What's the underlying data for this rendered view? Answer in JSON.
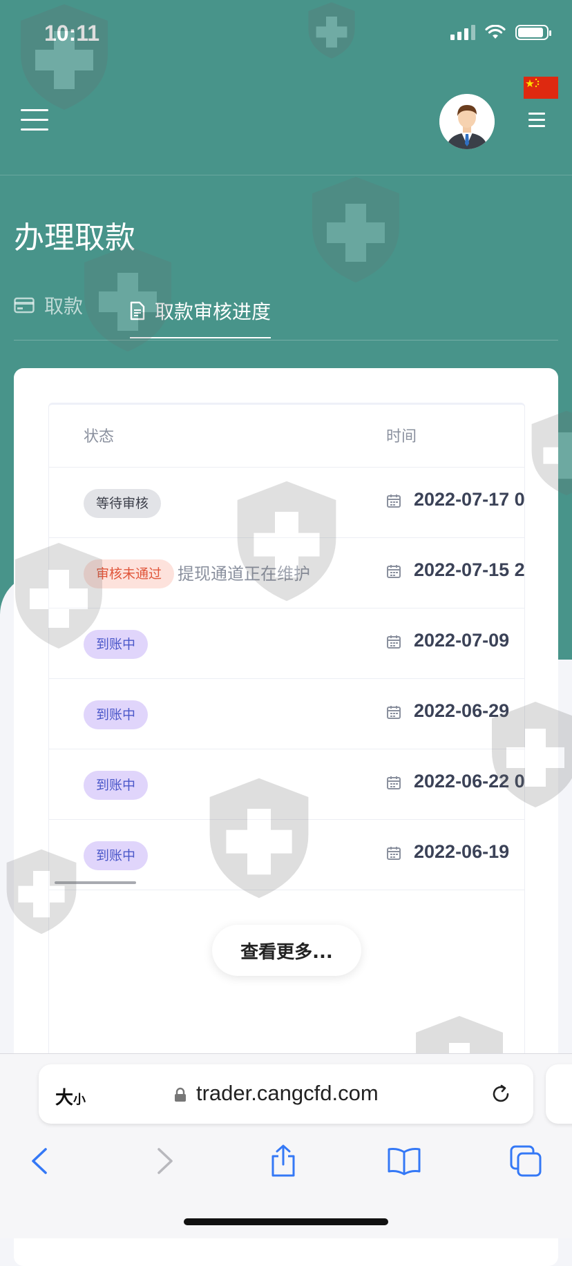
{
  "status_bar": {
    "time": "10:11"
  },
  "header": {
    "avatar_alt": "user avatar"
  },
  "page": {
    "title": "办理取款"
  },
  "tabs": [
    {
      "label": "取款",
      "active": false
    },
    {
      "label": "取款审核进度",
      "active": true
    }
  ],
  "table": {
    "headers": {
      "status": "状态",
      "time": "时间"
    },
    "rows": [
      {
        "status": "等待审核",
        "status_style": "gray",
        "note": "",
        "date": "2022-07-17 0"
      },
      {
        "status": "审核未通过",
        "status_style": "red",
        "note": "提现通道正在维护",
        "date": "2022-07-15 2"
      },
      {
        "status": "到账中",
        "status_style": "purple",
        "note": "",
        "date": "2022-07-09"
      },
      {
        "status": "到账中",
        "status_style": "purple",
        "note": "",
        "date": "2022-06-29"
      },
      {
        "status": "到账中",
        "status_style": "purple",
        "note": "",
        "date": "2022-06-22 0"
      },
      {
        "status": "到账中",
        "status_style": "purple",
        "note": "",
        "date": "2022-06-19"
      }
    ],
    "more_button": "查看更多..."
  },
  "browser": {
    "text_size_big": "大",
    "text_size_small": "小",
    "url": "trader.cangcfd.com"
  },
  "colors": {
    "primary": "#48948a",
    "badge_gray": "#e2e3e7",
    "badge_red": "#fde2dc",
    "badge_purple": "#e0d5fb",
    "ios_blue": "#3478f6"
  }
}
